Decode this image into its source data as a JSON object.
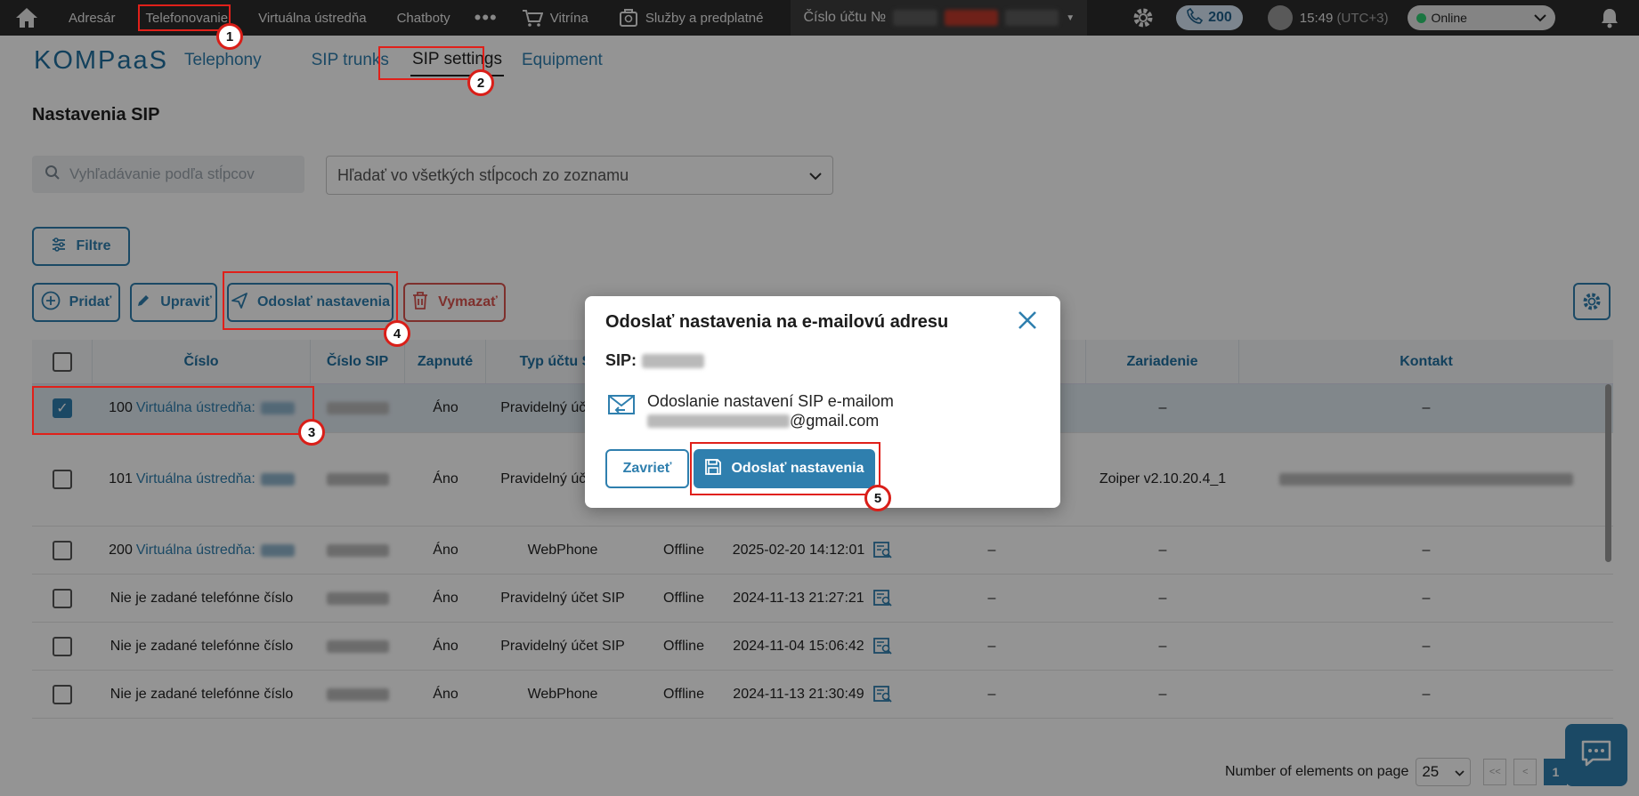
{
  "topbar": {
    "nav": [
      "Adresár",
      "Telefonovanie",
      "Virtuálna ústredňa",
      "Chatboty"
    ],
    "vitrina": "Vitrína",
    "services": "Služby a predplatné",
    "account_label": "Číslo účtu №",
    "calls_count": "200",
    "time": "15:49",
    "timezone": "(UTC+3)",
    "status": "Online"
  },
  "subnav": {
    "logo": "KOMPaaS",
    "tabs": [
      "Telephony",
      "SIP trunks",
      "SIP settings",
      "Equipment"
    ]
  },
  "page": {
    "title": "Nastavenia SIP",
    "search_placeholder": "Vyhľadávanie podľa stĺpcov",
    "column_select": "Hľadať vo všetkých stĺpcoch zo zoznamu"
  },
  "toolbar": {
    "filter": "Filtre",
    "add": "Pridať",
    "edit": "Upraviť",
    "send": "Odoslať nastavenia",
    "delete": "Vymazať"
  },
  "table": {
    "headers": [
      "Číslo",
      "Číslo SIP",
      "Zapnuté",
      "Typ účtu SIP",
      "",
      "",
      "",
      "Zariadenie",
      "Kontakt"
    ],
    "rows": [
      {
        "num": "100",
        "link": "Virtuálna ústredňa:",
        "on": "Áno",
        "type": "Pravidelný účet SIP",
        "status": "",
        "date": "",
        "device": "–",
        "contact": "–"
      },
      {
        "num": "101",
        "link": "Virtuálna ústredňa:",
        "on": "Áno",
        "type": "Pravidelný účet SIP",
        "status": "",
        "date": "",
        "device": "Zoiper v2.10.20.4_1",
        "contact": ""
      },
      {
        "num": "200",
        "link": "Virtuálna ústredňa:",
        "on": "Áno",
        "type": "WebPhone",
        "status": "Offline",
        "date": "2025-02-20 14:12:01",
        "device": "–",
        "contact": "–"
      },
      {
        "num": "Nie je zadané telefónne číslo",
        "link": "",
        "on": "Áno",
        "type": "Pravidelný účet SIP",
        "status": "Offline",
        "date": "2024-11-13 21:27:21",
        "device": "–",
        "contact": "–"
      },
      {
        "num": "Nie je zadané telefónne číslo",
        "link": "",
        "on": "Áno",
        "type": "Pravidelný účet SIP",
        "status": "Offline",
        "date": "2024-11-04 15:06:42",
        "device": "–",
        "contact": "–"
      },
      {
        "num": "Nie je zadané telefónne číslo",
        "link": "",
        "on": "Áno",
        "type": "WebPhone",
        "status": "Offline",
        "date": "2024-11-13 21:30:49",
        "device": "–",
        "contact": "–"
      }
    ],
    "dash": "–"
  },
  "pagination": {
    "label": "Number of elements on page",
    "size": "25",
    "first": "<<",
    "prev": "<",
    "page": "1"
  },
  "modal": {
    "title": "Odoslať nastavenia na e-mailovú adresu",
    "sip_label": "SIP:",
    "line1": "Odoslanie nastavení SIP e-mailom",
    "email_suffix": "@gmail.com",
    "cancel": "Zavrieť",
    "send": "Odoslať nastavenia"
  },
  "annotations": [
    "1",
    "2",
    "3",
    "4",
    "5"
  ],
  "colors": {
    "accent": "#2f7fae",
    "danger": "#d9534f",
    "annotation": "#e0201a"
  }
}
